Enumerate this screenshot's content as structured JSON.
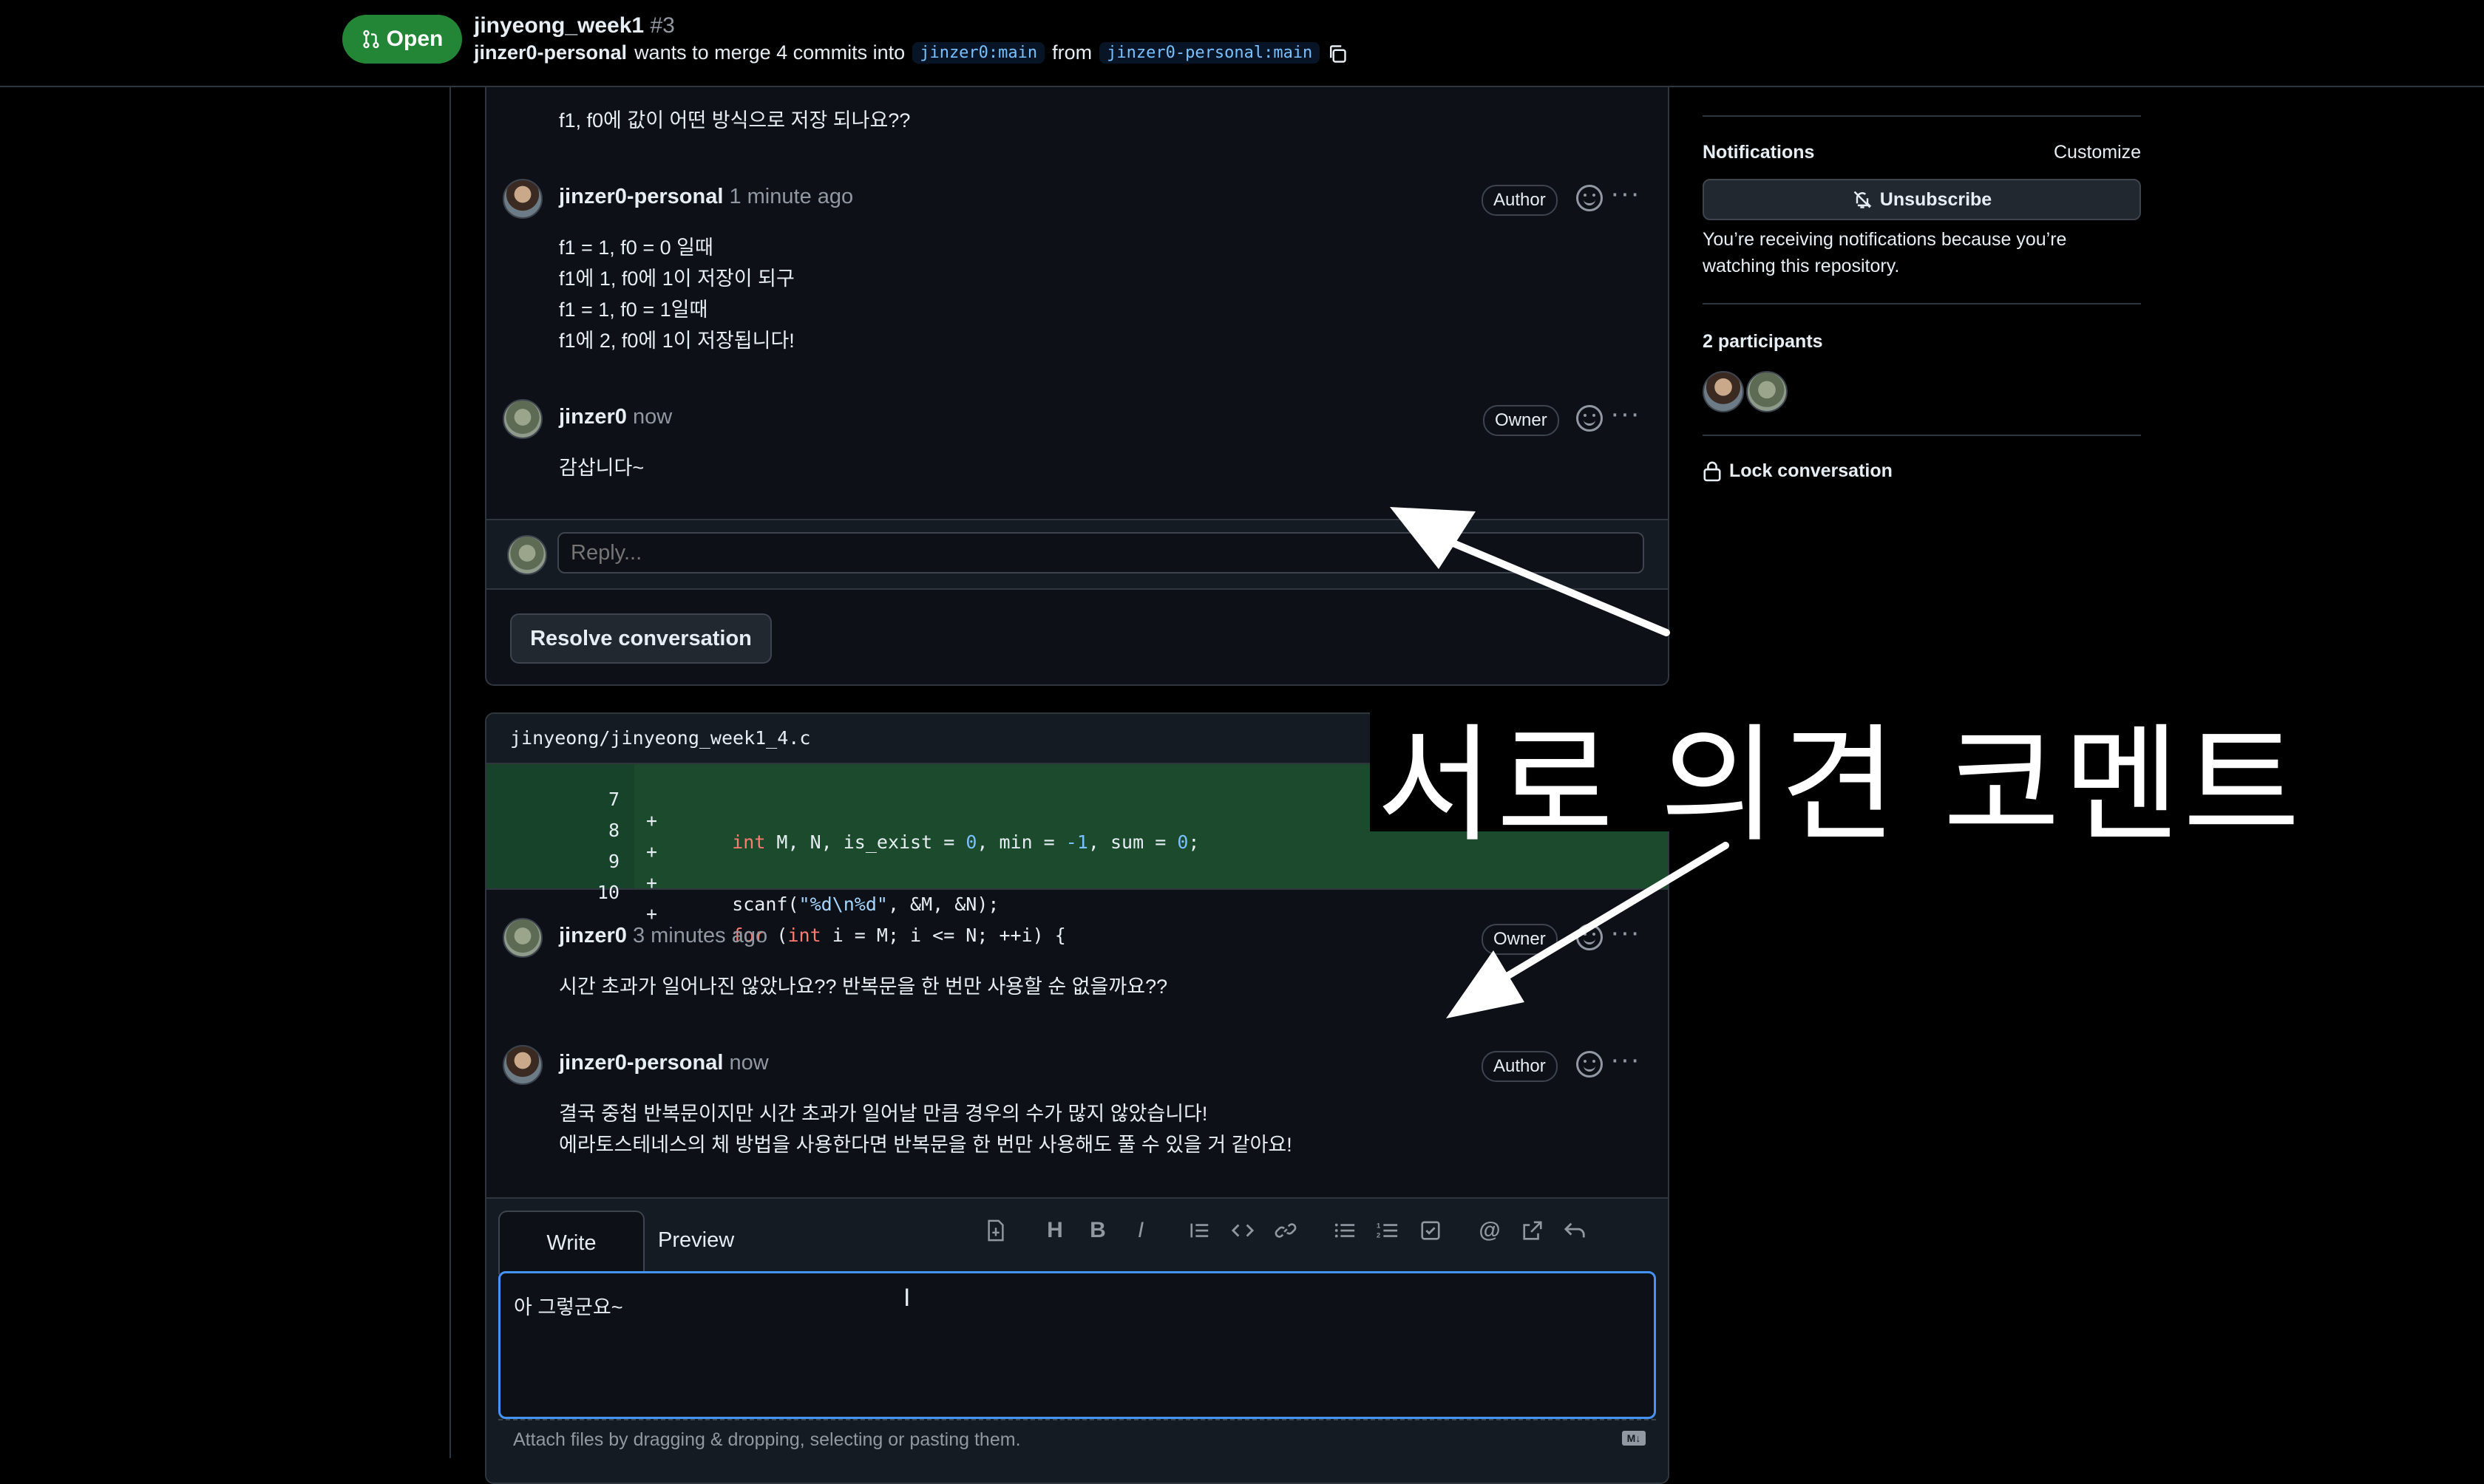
{
  "header": {
    "state": "Open",
    "title": "jinyeong_week1",
    "number": "#3",
    "author": "jinzer0-personal",
    "merge_text": "wants to merge 4 commits into",
    "base_branch": "jinzer0:main",
    "from_text": "from",
    "head_branch": "jinzer0-personal:main"
  },
  "thread1": {
    "prev_comment": "f1, f0에 값이 어떤 방식으로 저장 되나요??",
    "comments": [
      {
        "author": "jinzer0-personal",
        "time": "1 minute ago",
        "role": "Author",
        "lines": [
          "f1 = 1, f0 = 0 일때",
          "f1에 1, f0에 1이 저장이 되구",
          "f1 = 1, f0 = 1일때",
          "f1에 2, f0에 1이 저장됩니다!"
        ]
      },
      {
        "author": "jinzer0",
        "time": "now",
        "role": "Owner",
        "lines": [
          "감삽니다~"
        ]
      }
    ],
    "reply_placeholder": "Reply...",
    "resolve_label": "Resolve conversation"
  },
  "thread2": {
    "file_path": "jinyeong/jinyeong_week1_4.c",
    "diff": [
      {
        "line": "7",
        "sign": "+"
      },
      {
        "line": "8",
        "sign": "+"
      },
      {
        "line": "9",
        "sign": "+"
      },
      {
        "line": "10",
        "sign": "+"
      }
    ],
    "comments": [
      {
        "author": "jinzer0",
        "time": "3 minutes ago",
        "role": "Owner",
        "lines": [
          "시간 초과가 일어나진 않았나요?? 반복문을 한 번만 사용할 순 없을까요??"
        ]
      },
      {
        "author": "jinzer0-personal",
        "time": "now",
        "role": "Author",
        "lines": [
          "결국 중첩 반복문이지만 시간 초과가 일어날 만큼 경우의 수가 많지 않았습니다!",
          "에라토스테네스의 체 방법을 사용한다면 반복문을 한 번만 사용해도 풀 수 있을 거 같아요!"
        ]
      }
    ],
    "editor": {
      "tab_write": "Write",
      "tab_preview": "Preview",
      "value": "아 그렇군요~",
      "attach_hint": "Attach files by dragging & dropping, selecting or pasting them.",
      "toolbar_icons": [
        "add-file-icon",
        "heading-icon",
        "bold-icon",
        "italic-icon",
        "quote-icon",
        "code-icon",
        "link-icon",
        "unordered-list-icon",
        "ordered-list-icon",
        "task-list-icon",
        "mention-icon",
        "cross-reference-icon",
        "undo-icon"
      ]
    }
  },
  "sidebar": {
    "notifications_title": "Notifications",
    "customize": "Customize",
    "unsubscribe": "Unsubscribe",
    "notice": "You’re receiving notifications because you’re watching this repository.",
    "participants_title": "2 participants",
    "lock": "Lock conversation"
  },
  "annotation": {
    "caption": "서로 의견 코멘트",
    "color": "#ffffff"
  },
  "colors": {
    "open_green": "#238636",
    "diff_add_bg": "#1b4b2c",
    "focus_blue": "#4493f8",
    "background": "#000000"
  }
}
